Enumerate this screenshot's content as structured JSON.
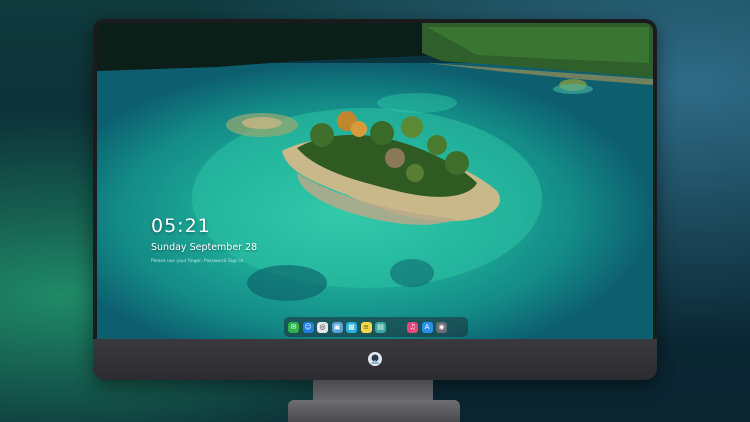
{
  "lock_screen": {
    "time": "05:21",
    "date": "Sunday September 28",
    "hint": "Please use your finger, Password/ Sign in."
  },
  "dock": {
    "items": [
      {
        "name": "messages-icon",
        "color": "#2fb34a",
        "glyph": "✉"
      },
      {
        "name": "finder-icon",
        "color": "#1f7fe0",
        "glyph": "☺"
      },
      {
        "name": "safari-icon",
        "color": "#e8e8e8",
        "glyph": "◎"
      },
      {
        "name": "preview-icon",
        "color": "#5aa0d8",
        "glyph": "▣"
      },
      {
        "name": "clapper-icon",
        "color": "#2ab0e0",
        "glyph": "▦"
      },
      {
        "name": "notes-icon",
        "color": "#f5d64a",
        "glyph": "≡"
      },
      {
        "name": "photos-icon",
        "color": "#3ea8a0",
        "glyph": "▤"
      },
      {
        "name": "music-icon",
        "color": "#e8457a",
        "glyph": "♫"
      },
      {
        "name": "app-store-icon",
        "color": "#2b8fef",
        "glyph": "A"
      },
      {
        "name": "camera-icon",
        "color": "#6d6d75",
        "glyph": "◉"
      }
    ]
  },
  "colors": {
    "water_deep": "#0d4a58",
    "water_shallow": "#29c0a8",
    "island": "#2f5a22"
  }
}
